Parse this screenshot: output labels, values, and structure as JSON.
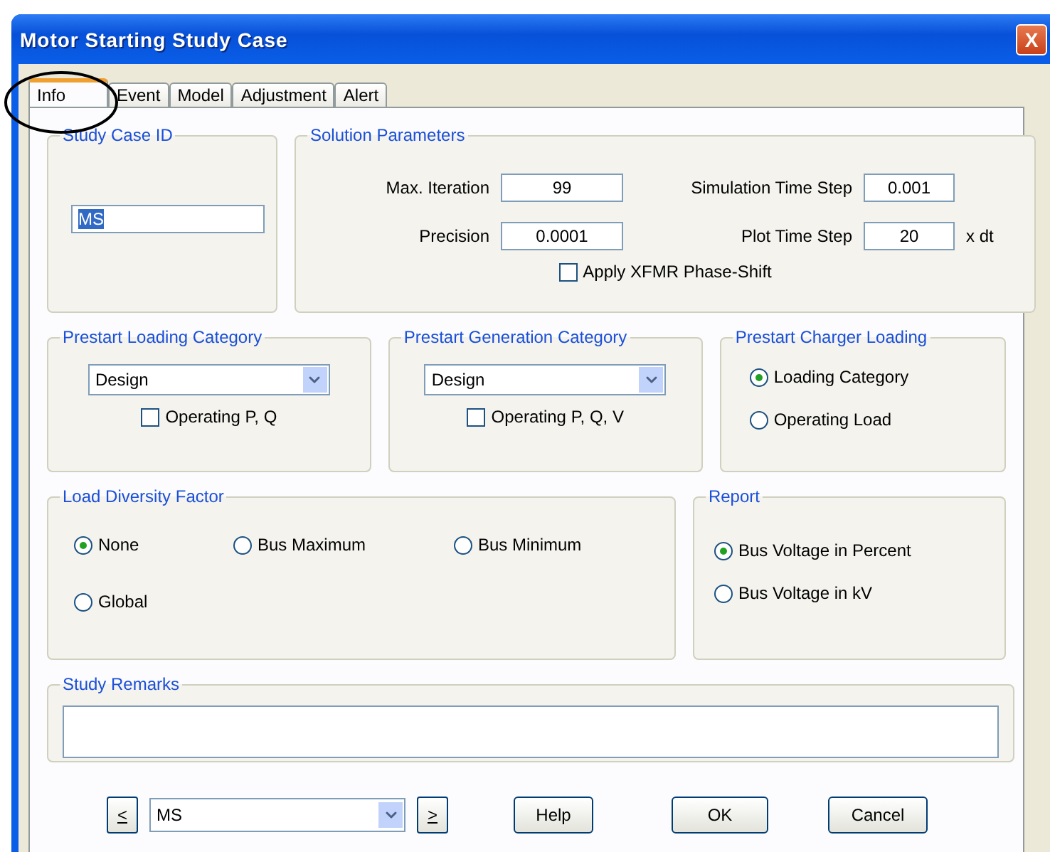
{
  "window": {
    "title": "Motor Starting Study Case",
    "close": "X"
  },
  "tabs": [
    {
      "label": "Info",
      "selected": true
    },
    {
      "label": "Event",
      "selected": false
    },
    {
      "label": "Model",
      "selected": false
    },
    {
      "label": "Adjustment",
      "selected": false
    },
    {
      "label": "Alert",
      "selected": false
    }
  ],
  "study_case_id": {
    "title": "Study Case ID",
    "value": "MS",
    "text_selected": true
  },
  "solution_parameters": {
    "title": "Solution Parameters",
    "fields": [
      {
        "label": "Max. Iteration",
        "value": "99"
      },
      {
        "label": "Simulation Time Step",
        "value": "0.001"
      },
      {
        "label": "Precision",
        "value": "0.0001"
      },
      {
        "label": "Plot Time Step",
        "value": "20",
        "unit": "x  dt"
      }
    ],
    "checkbox": {
      "label": "Apply XFMR Phase-Shift",
      "checked": false
    }
  },
  "prestart_loading": {
    "title": "Prestart Loading Category",
    "dropdown": "Design",
    "checkbox": {
      "label": "Operating P, Q",
      "checked": false
    }
  },
  "prestart_generation": {
    "title": "Prestart Generation Category",
    "dropdown": "Design",
    "checkbox": {
      "label": "Operating P, Q, V",
      "checked": false
    }
  },
  "prestart_charger": {
    "title": "Prestart Charger Loading",
    "options": [
      {
        "label": "Loading Category",
        "selected": true
      },
      {
        "label": "Operating Load",
        "selected": false
      }
    ]
  },
  "load_diversity": {
    "title": "Load Diversity Factor",
    "options": [
      {
        "label": "None",
        "selected": true
      },
      {
        "label": "Bus Maximum",
        "selected": false
      },
      {
        "label": "Bus Minimum",
        "selected": false
      },
      {
        "label": "Global",
        "selected": false
      }
    ]
  },
  "report": {
    "title": "Report",
    "options": [
      {
        "label": "Bus Voltage in Percent",
        "selected": true
      },
      {
        "label": "Bus Voltage in kV",
        "selected": false
      }
    ]
  },
  "study_remarks": {
    "title": "Study Remarks"
  },
  "footer": {
    "prev": "<",
    "case": "MS",
    "next": ">",
    "buttons": [
      "Help",
      "OK",
      "Cancel"
    ]
  },
  "annotation": {
    "kind": "ellipse"
  }
}
